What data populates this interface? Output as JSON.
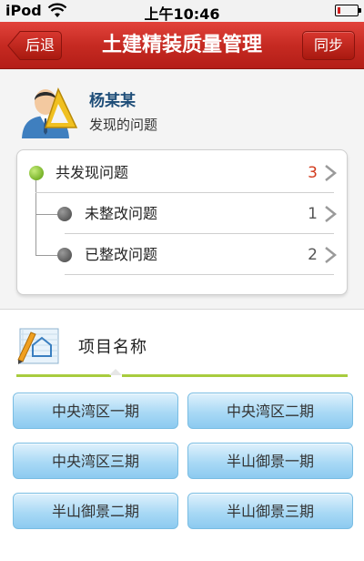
{
  "status_bar": {
    "carrier": "iPod",
    "time": "上午10:46",
    "wifi_icon": "wifi-icon",
    "battery_icon": "battery-low-icon",
    "battery_level": 0.12
  },
  "nav": {
    "title": "土建精装质量管理",
    "back_label": "后退",
    "sync_label": "同步",
    "accent_color": "#c62a22"
  },
  "user": {
    "name": "杨某某",
    "subtitle": "发现的问题",
    "avatar_icon": "engineer-avatar-icon"
  },
  "issues": [
    {
      "label": "共发现问题",
      "count": "3",
      "status_color": "#78b32a",
      "count_color": "#d23a1c"
    },
    {
      "label": "未整改问题",
      "count": "1",
      "status_color": "#5b5b5b",
      "count_color": "#555555"
    },
    {
      "label": "已整改问题",
      "count": "2",
      "status_color": "#5b5b5b",
      "count_color": "#555555"
    }
  ],
  "projects": {
    "header": "项目名称",
    "header_icon": "project-edit-icon",
    "items": [
      "中央湾区一期",
      "中央湾区二期",
      "中央湾区三期",
      "半山御景一期",
      "半山御景二期",
      "半山御景三期"
    ]
  }
}
